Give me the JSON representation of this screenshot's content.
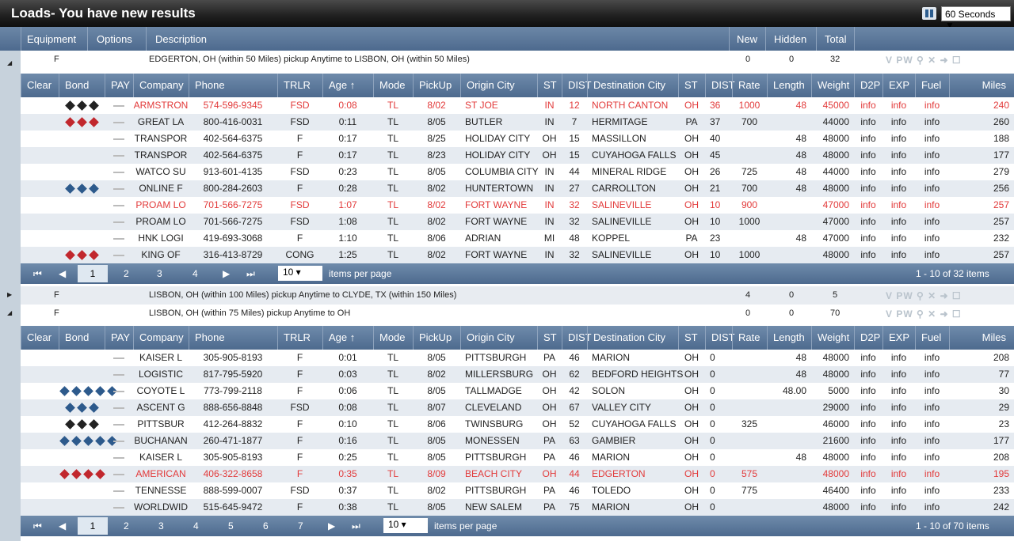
{
  "title": "Loads- You have new results",
  "refresh": "60 Seconds ▼",
  "toolbar": {
    "equipment": "Equipment",
    "options": "Options",
    "description": "Description",
    "new": "New",
    "hidden": "Hidden",
    "total": "Total"
  },
  "icons": {
    "actions": "V PW ⚲ ✕ ➜ ☐"
  },
  "group1": {
    "equip": "F",
    "desc": "EDGERTON, OH (within 50 Miles) pickup Anytime to LISBON, OH (within 50 Miles)",
    "new": "0",
    "hidden": "0",
    "total": "32"
  },
  "group2": {
    "equip": "F",
    "desc": "LISBON, OH (within 100 Miles) pickup Anytime to CLYDE, TX (within 150 Miles)",
    "new": "4",
    "hidden": "0",
    "total": "5"
  },
  "group3": {
    "equip": "F",
    "desc": "LISBON, OH (within 75 Miles) pickup Anytime to OH",
    "new": "0",
    "hidden": "0",
    "total": "70"
  },
  "columns": [
    "Clear",
    "Bond",
    "PAY",
    "Company",
    "Phone",
    "TRLR",
    "Age ↑",
    "Mode",
    "PickUp",
    "Origin City",
    "ST",
    "DIST",
    "Destination City",
    "ST",
    "DIST",
    "Rate",
    "Length",
    "Weight",
    "D2P",
    "EXP",
    "Fuel",
    "Miles"
  ],
  "grid1": [
    {
      "bond": "3-black",
      "company": "ARMSTRON",
      "phone": "574-596-9345",
      "trlr": "FSD",
      "age": "0:08",
      "mode": "TL",
      "pickup": "8/02",
      "origin": "ST JOE",
      "ost": "IN",
      "odist": "12",
      "dest": "NORTH CANTON",
      "dst": "OH",
      "ddist": "36",
      "rate": "1000",
      "length": "48",
      "weight": "45000",
      "miles": "240",
      "red": true
    },
    {
      "bond": "3-red",
      "company": "GREAT LA",
      "phone": "800-416-0031",
      "trlr": "FSD",
      "age": "0:11",
      "mode": "TL",
      "pickup": "8/05",
      "origin": "BUTLER",
      "ost": "IN",
      "odist": "7",
      "dest": "HERMITAGE",
      "dst": "PA",
      "ddist": "37",
      "rate": "700",
      "length": "",
      "weight": "44000",
      "miles": "260"
    },
    {
      "bond": "",
      "company": "TRANSPOR",
      "phone": "402-564-6375",
      "trlr": "F",
      "age": "0:17",
      "mode": "TL",
      "pickup": "8/25",
      "origin": "HOLIDAY CITY",
      "ost": "OH",
      "odist": "15",
      "dest": "MASSILLON",
      "dst": "OH",
      "ddist": "40",
      "rate": "",
      "length": "48",
      "weight": "48000",
      "miles": "188"
    },
    {
      "bond": "",
      "company": "TRANSPOR",
      "phone": "402-564-6375",
      "trlr": "F",
      "age": "0:17",
      "mode": "TL",
      "pickup": "8/23",
      "origin": "HOLIDAY CITY",
      "ost": "OH",
      "odist": "15",
      "dest": "CUYAHOGA FALLS",
      "dst": "OH",
      "ddist": "45",
      "rate": "",
      "length": "48",
      "weight": "48000",
      "miles": "177"
    },
    {
      "bond": "",
      "company": "WATCO SU",
      "phone": "913-601-4135",
      "trlr": "FSD",
      "age": "0:23",
      "mode": "TL",
      "pickup": "8/05",
      "origin": "COLUMBIA CITY",
      "ost": "IN",
      "odist": "44",
      "dest": "MINERAL RIDGE",
      "dst": "OH",
      "ddist": "26",
      "rate": "725",
      "length": "48",
      "weight": "44000",
      "miles": "279"
    },
    {
      "bond": "3-blue",
      "company": "ONLINE F",
      "phone": "800-284-2603",
      "trlr": "F",
      "age": "0:28",
      "mode": "TL",
      "pickup": "8/02",
      "origin": "HUNTERTOWN",
      "ost": "IN",
      "odist": "27",
      "dest": "CARROLLTON",
      "dst": "OH",
      "ddist": "21",
      "rate": "700",
      "length": "48",
      "weight": "48000",
      "miles": "256"
    },
    {
      "bond": "",
      "company": "PROAM LO",
      "phone": "701-566-7275",
      "trlr": "FSD",
      "age": "1:07",
      "mode": "TL",
      "pickup": "8/02",
      "origin": "FORT WAYNE",
      "ost": "IN",
      "odist": "32",
      "dest": "SALINEVILLE",
      "dst": "OH",
      "ddist": "10",
      "rate": "900",
      "length": "",
      "weight": "47000",
      "miles": "257",
      "red": true
    },
    {
      "bond": "",
      "company": "PROAM LO",
      "phone": "701-566-7275",
      "trlr": "FSD",
      "age": "1:08",
      "mode": "TL",
      "pickup": "8/02",
      "origin": "FORT WAYNE",
      "ost": "IN",
      "odist": "32",
      "dest": "SALINEVILLE",
      "dst": "OH",
      "ddist": "10",
      "rate": "1000",
      "length": "",
      "weight": "47000",
      "miles": "257"
    },
    {
      "bond": "",
      "company": "HNK LOGI",
      "phone": "419-693-3068",
      "trlr": "F",
      "age": "1:10",
      "mode": "TL",
      "pickup": "8/06",
      "origin": "ADRIAN",
      "ost": "MI",
      "odist": "48",
      "dest": "KOPPEL",
      "dst": "PA",
      "ddist": "23",
      "rate": "",
      "length": "48",
      "weight": "47000",
      "miles": "232"
    },
    {
      "bond": "3-red",
      "company": "KING OF",
      "phone": "316-413-8729",
      "trlr": "CONG",
      "age": "1:25",
      "mode": "TL",
      "pickup": "8/02",
      "origin": "FORT WAYNE",
      "ost": "IN",
      "odist": "32",
      "dest": "SALINEVILLE",
      "dst": "OH",
      "ddist": "10",
      "rate": "1000",
      "length": "",
      "weight": "48000",
      "miles": "257"
    }
  ],
  "grid2": [
    {
      "bond": "",
      "company": "KAISER L",
      "phone": "305-905-8193",
      "trlr": "F",
      "age": "0:01",
      "mode": "TL",
      "pickup": "8/05",
      "origin": "PITTSBURGH",
      "ost": "PA",
      "odist": "46",
      "dest": "MARION",
      "dst": "OH",
      "ddist": "0",
      "rate": "",
      "length": "48",
      "weight": "48000",
      "miles": "208"
    },
    {
      "bond": "",
      "company": "LOGISTIC",
      "phone": "817-795-5920",
      "trlr": "F",
      "age": "0:03",
      "mode": "TL",
      "pickup": "8/02",
      "origin": "MILLERSBURG",
      "ost": "OH",
      "odist": "62",
      "dest": "BEDFORD HEIGHTS",
      "dst": "OH",
      "ddist": "0",
      "rate": "",
      "length": "48",
      "weight": "48000",
      "miles": "77"
    },
    {
      "bond": "5-blue",
      "company": "COYOTE L",
      "phone": "773-799-2118",
      "trlr": "F",
      "age": "0:06",
      "mode": "TL",
      "pickup": "8/05",
      "origin": "TALLMADGE",
      "ost": "OH",
      "odist": "42",
      "dest": "SOLON",
      "dst": "OH",
      "ddist": "0",
      "rate": "",
      "length": "48.00",
      "weight": "5000",
      "miles": "30"
    },
    {
      "bond": "3-blue",
      "company": "ASCENT G",
      "phone": "888-656-8848",
      "trlr": "FSD",
      "age": "0:08",
      "mode": "TL",
      "pickup": "8/07",
      "origin": "CLEVELAND",
      "ost": "OH",
      "odist": "67",
      "dest": "VALLEY CITY",
      "dst": "OH",
      "ddist": "0",
      "rate": "",
      "length": "",
      "weight": "29000",
      "miles": "29"
    },
    {
      "bond": "3-black",
      "company": "PITTSBUR",
      "phone": "412-264-8832",
      "trlr": "F",
      "age": "0:10",
      "mode": "TL",
      "pickup": "8/06",
      "origin": "TWINSBURG",
      "ost": "OH",
      "odist": "52",
      "dest": "CUYAHOGA FALLS",
      "dst": "OH",
      "ddist": "0",
      "rate": "325",
      "length": "",
      "weight": "46000",
      "miles": "23"
    },
    {
      "bond": "5-blue",
      "company": "BUCHANAN",
      "phone": "260-471-1877",
      "trlr": "F",
      "age": "0:16",
      "mode": "TL",
      "pickup": "8/05",
      "origin": "MONESSEN",
      "ost": "PA",
      "odist": "63",
      "dest": "GAMBIER",
      "dst": "OH",
      "ddist": "0",
      "rate": "",
      "length": "",
      "weight": "21600",
      "miles": "177"
    },
    {
      "bond": "",
      "company": "KAISER L",
      "phone": "305-905-8193",
      "trlr": "F",
      "age": "0:25",
      "mode": "TL",
      "pickup": "8/05",
      "origin": "PITTSBURGH",
      "ost": "PA",
      "odist": "46",
      "dest": "MARION",
      "dst": "OH",
      "ddist": "0",
      "rate": "",
      "length": "48",
      "weight": "48000",
      "miles": "208"
    },
    {
      "bond": "4-red",
      "company": "AMERICAN",
      "phone": "406-322-8658",
      "trlr": "F",
      "age": "0:35",
      "mode": "TL",
      "pickup": "8/09",
      "origin": "BEACH CITY",
      "ost": "OH",
      "odist": "44",
      "dest": "EDGERTON",
      "dst": "OH",
      "ddist": "0",
      "rate": "575",
      "length": "",
      "weight": "48000",
      "miles": "195",
      "red": true
    },
    {
      "bond": "",
      "company": "TENNESSE",
      "phone": "888-599-0007",
      "trlr": "FSD",
      "age": "0:37",
      "mode": "TL",
      "pickup": "8/02",
      "origin": "PITTSBURGH",
      "ost": "PA",
      "odist": "46",
      "dest": "TOLEDO",
      "dst": "OH",
      "ddist": "0",
      "rate": "775",
      "length": "",
      "weight": "46400",
      "miles": "233"
    },
    {
      "bond": "",
      "company": "WORLDWID",
      "phone": "515-645-9472",
      "trlr": "F",
      "age": "0:38",
      "mode": "TL",
      "pickup": "8/05",
      "origin": "NEW SALEM",
      "ost": "PA",
      "odist": "75",
      "dest": "MARION",
      "dst": "OH",
      "ddist": "0",
      "rate": "",
      "length": "",
      "weight": "48000",
      "miles": "242"
    }
  ],
  "info": "info",
  "pager1": {
    "pages": [
      "1",
      "2",
      "3",
      "4"
    ],
    "perpage": "10",
    "perlabel": "items per page",
    "summary": "1 - 10 of 32 items"
  },
  "pager2": {
    "pages": [
      "1",
      "2",
      "3",
      "4",
      "5",
      "6",
      "7"
    ],
    "perpage": "10",
    "perlabel": "items per page",
    "summary": "1 - 10 of 70 items"
  }
}
